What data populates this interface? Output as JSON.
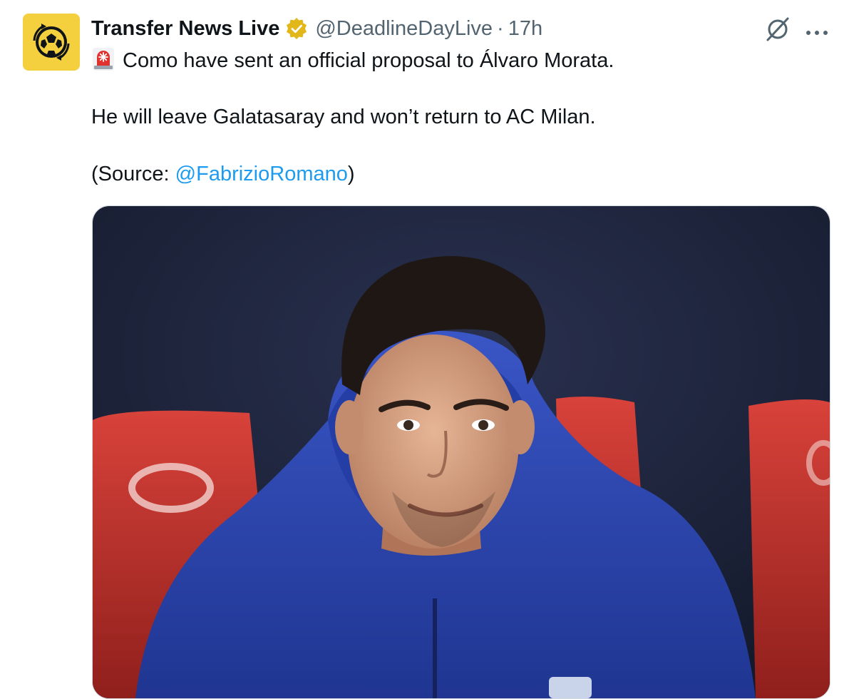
{
  "tweet": {
    "author_name": "Transfer News Live",
    "handle": "@DeadlineDayLive",
    "separator": "·",
    "time": "17h",
    "line1": "Como have sent an official proposal to Álvaro Morata.",
    "line2": "He will leave Galatasaray and won’t return to AC Milan.",
    "source_prefix": "(Source: ",
    "source_mention": "@FabrizioRomano",
    "source_suffix": ")"
  },
  "icons": {
    "avatar": "football-logo",
    "verified": "verified-badge-icon",
    "grok": "grok-icon",
    "more": "more-icon",
    "siren": "siren-icon"
  },
  "colors": {
    "avatar_bg": "#f4d03f",
    "verified_gold": "#e2b719",
    "link": "#1d9bf0",
    "secondary_text": "#536471",
    "jacket_blue": "#2c44b0",
    "seat_red": "#c8322e",
    "background_navy": "#1c2238"
  }
}
